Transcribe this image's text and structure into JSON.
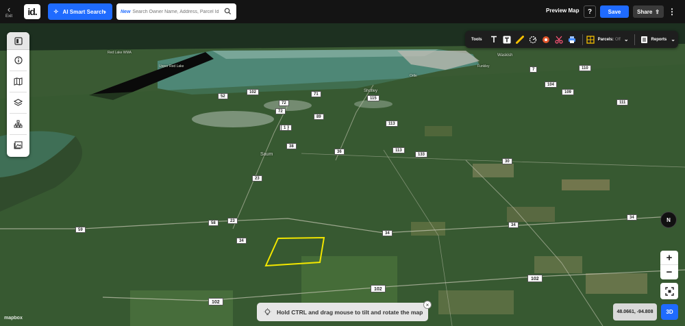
{
  "topbar": {
    "exit_label": "Exit",
    "logo_text": "id.",
    "ai_search_label": "AI Smart Search",
    "search_new_badge": "New",
    "search_placeholder": "Search Owner Name, Address, Parcel Id",
    "preview_map_label": "Preview Map",
    "help_label": "?",
    "save_label": "Save",
    "share_label": "Share",
    "more_label": "⋮"
  },
  "left_toolbar": {
    "items": [
      "panel-toggle",
      "info",
      "map",
      "layers",
      "hierarchy",
      "image-gallery"
    ]
  },
  "tools_panel": {
    "tools_label": "Tools",
    "parcels_label": "Parcels:",
    "parcels_state": "Off",
    "reports_label": "Reports"
  },
  "map_controls": {
    "compass_label": "N",
    "zoom_in": "+",
    "zoom_out": "−",
    "three_d_label": "3D",
    "coordinates": "48.0661, -94.808"
  },
  "hint": {
    "text": "Hold CTRL and drag mouse to tilt and rotate the map",
    "close": "×"
  },
  "attribution": "mapbox",
  "map_labels": {
    "places": [
      "Saum",
      "Shotley",
      "Waskish",
      "Upper Red Lake",
      "Red Lake WMA",
      "Ortle",
      "Funkley"
    ],
    "roads": [
      "102",
      "102",
      "102",
      "34",
      "34",
      "34",
      "34",
      "59",
      "58",
      "23",
      "23",
      "30",
      "38",
      "36",
      "113",
      "113",
      "110",
      "72",
      "71",
      "72",
      "1",
      "115",
      "109",
      "110",
      "111",
      "104",
      "7",
      "89",
      "102",
      "52",
      "133"
    ]
  },
  "colors": {
    "accent": "#1f6bff",
    "parcel_outline": "#f2e600",
    "topbar_bg": "#141414"
  }
}
